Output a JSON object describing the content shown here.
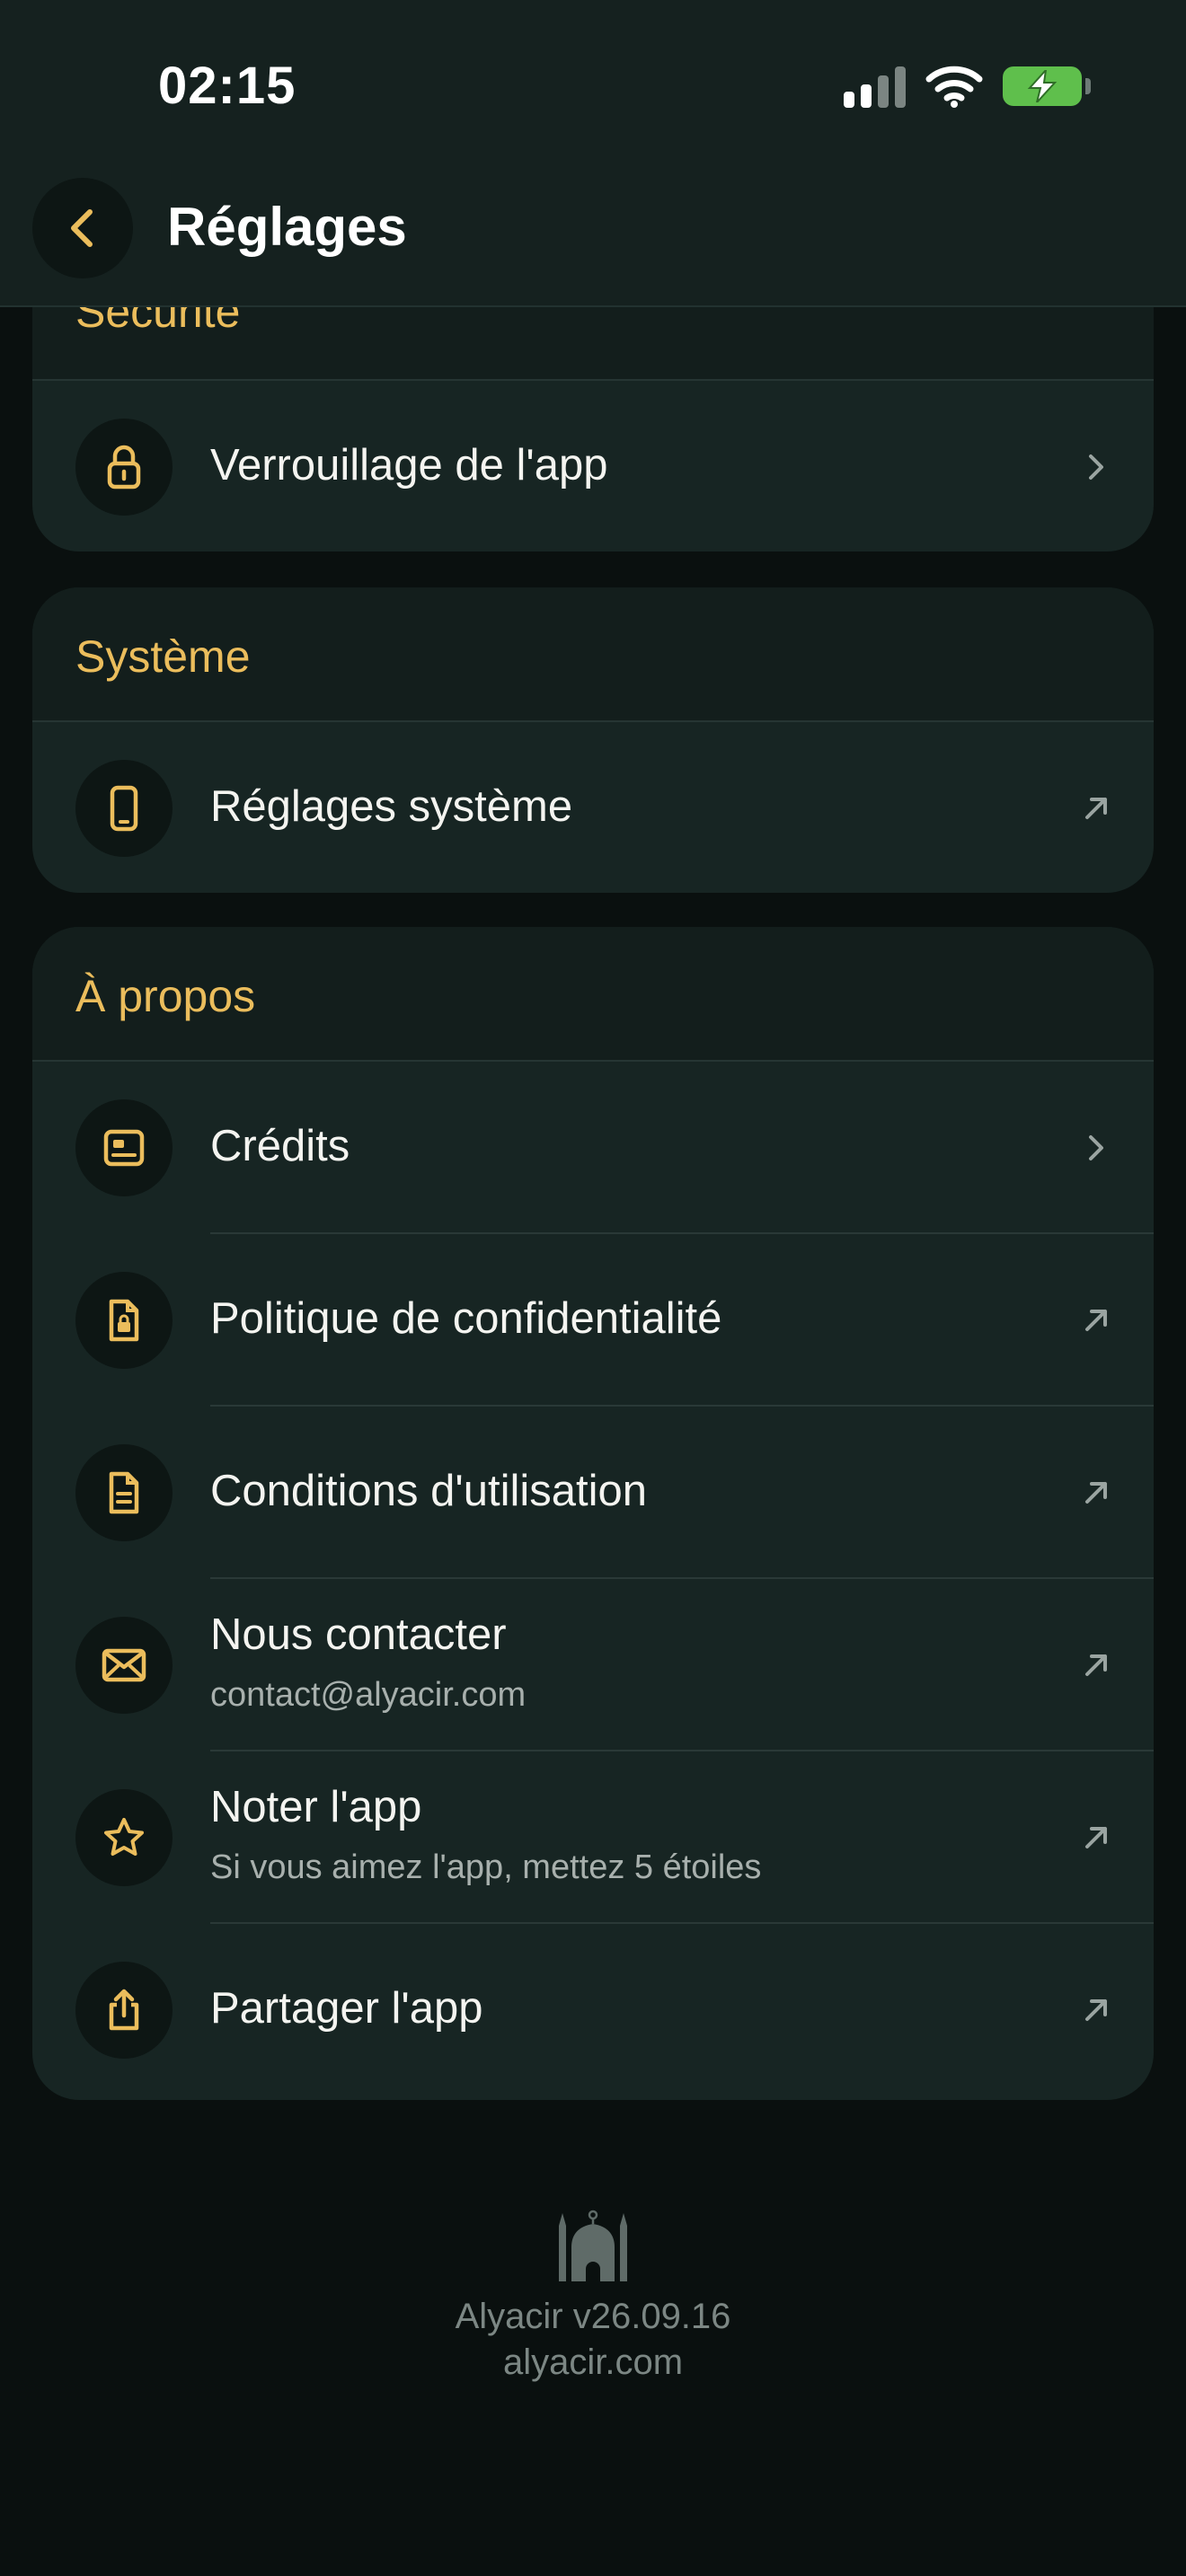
{
  "status_bar": {
    "time": "02:15"
  },
  "header": {
    "title": "Réglages",
    "back_icon": "chevron-left-icon"
  },
  "colors": {
    "accent": "#ebbd5c",
    "card": "#172523",
    "background": "#0a100f",
    "battery": "#5fbf4c"
  },
  "sections": {
    "security": {
      "title": "Sécurité",
      "items": [
        {
          "label": "Verrouillage de l'app",
          "icon": "lock-icon",
          "trail": "chevron-right-icon"
        }
      ]
    },
    "system": {
      "title": "Système",
      "items": [
        {
          "label": "Réglages système",
          "icon": "phone-icon",
          "trail": "external-arrow-icon"
        }
      ]
    },
    "about": {
      "title": "À propos",
      "items": [
        {
          "label": "Crédits",
          "icon": "id-card-icon",
          "trail": "chevron-right-icon"
        },
        {
          "label": "Politique de confidentialité",
          "icon": "document-lock-icon",
          "trail": "external-arrow-icon"
        },
        {
          "label": "Conditions d'utilisation",
          "icon": "document-text-icon",
          "trail": "external-arrow-icon"
        },
        {
          "label": "Nous contacter",
          "sublabel": "contact@alyacir.com",
          "icon": "envelope-icon",
          "trail": "external-arrow-icon"
        },
        {
          "label": "Noter l'app",
          "sublabel": "Si vous aimez l'app, mettez 5 étoiles",
          "icon": "star-icon",
          "trail": "external-arrow-icon"
        },
        {
          "label": "Partager l'app",
          "icon": "share-icon",
          "trail": "external-arrow-icon"
        }
      ]
    }
  },
  "footer": {
    "logo": "mosque-icon",
    "version": "Alyacir v26.09.16",
    "website": "alyacir.com"
  }
}
